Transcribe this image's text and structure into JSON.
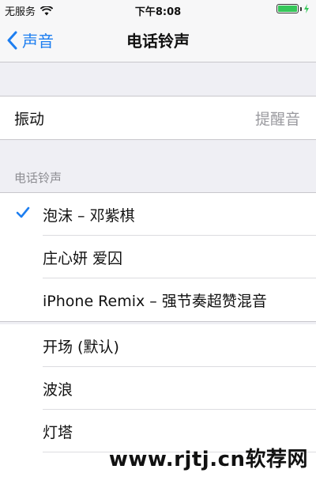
{
  "status_bar": {
    "carrier": "无服务",
    "time": "下午8:08"
  },
  "nav": {
    "back_label": "声音",
    "title": "电话铃声"
  },
  "vibration": {
    "label": "振动",
    "value": "提醒音"
  },
  "ringtones": {
    "header": "电话铃声",
    "custom": [
      {
        "label": "泡沫 – 邓紫棋",
        "selected": true
      },
      {
        "label": "庄心妍 爱囚",
        "selected": false
      },
      {
        "label": "iPhone Remix – 强节奏超赞混音",
        "selected": false
      }
    ],
    "builtin": [
      {
        "label": "开场 (默认)"
      },
      {
        "label": "波浪"
      },
      {
        "label": "灯塔"
      }
    ]
  },
  "watermark": "www.rjtj.cn软荐网",
  "colors": {
    "accent": "#1d7ef0",
    "battery": "#35c759",
    "background": "#efeff4"
  }
}
